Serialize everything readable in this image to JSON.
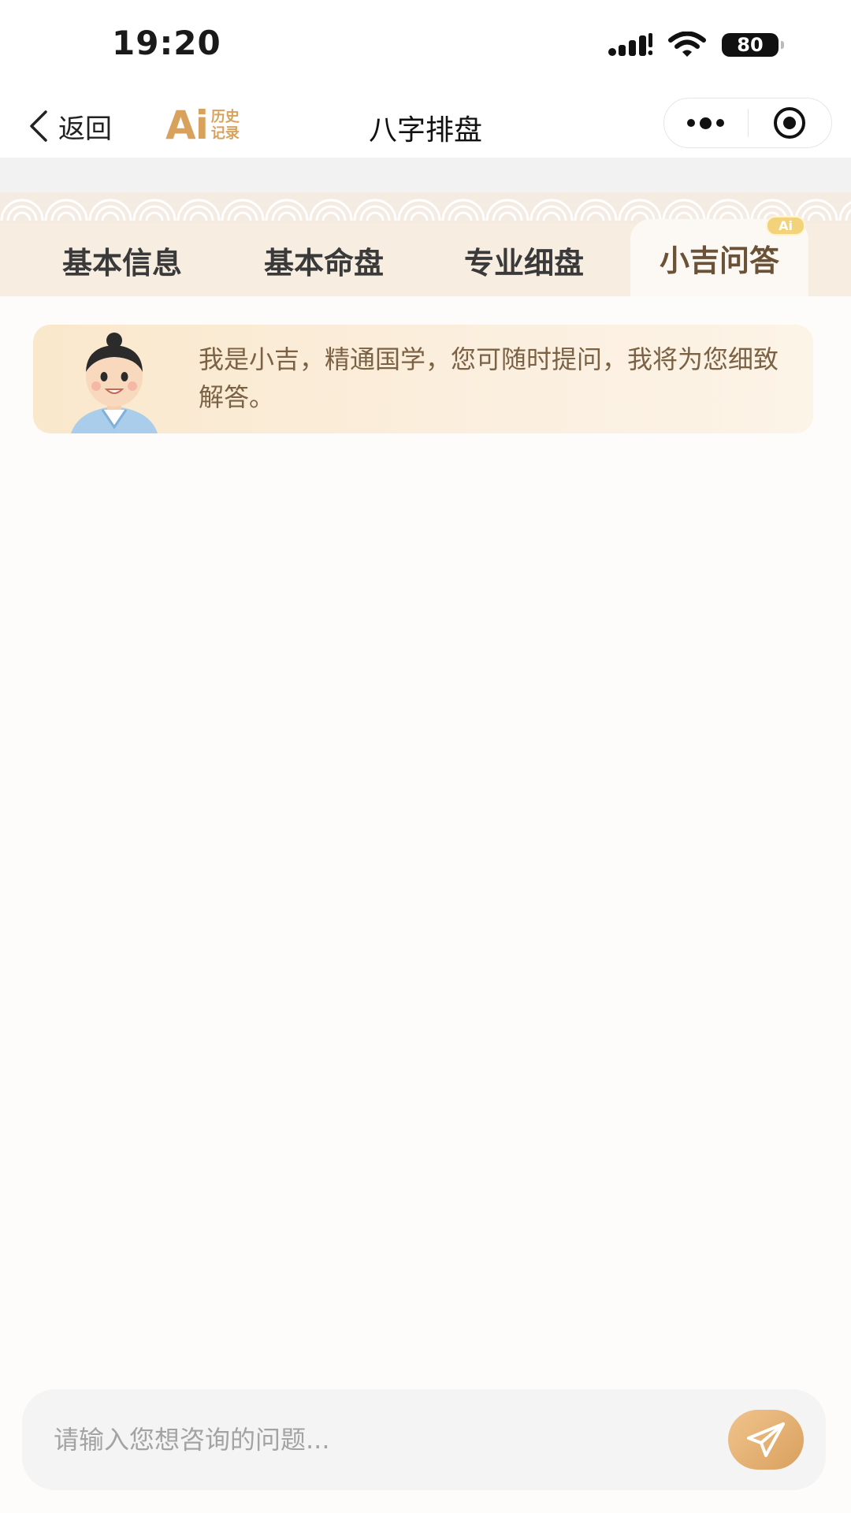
{
  "status_bar": {
    "time": "19:20",
    "battery": "80"
  },
  "nav": {
    "back_label": "返回",
    "ai_mark": "Ai",
    "history_label_line1": "历史",
    "history_label_line2": "记录",
    "title": "八字排盘"
  },
  "tabs": [
    {
      "label": "基本信息"
    },
    {
      "label": "基本命盘"
    },
    {
      "label": "专业细盘"
    },
    {
      "label": "小吉问答",
      "badge": "Ai",
      "active": true
    }
  ],
  "intro": {
    "text": "我是小吉，精通国学，您可随时提问，我将为您细致解答。"
  },
  "chat_input": {
    "placeholder": "请输入您想咨询的问题..."
  },
  "colors": {
    "accent": "#d9a25c",
    "tab_bar": "#f7ede0",
    "intro_text": "#7c6244"
  }
}
